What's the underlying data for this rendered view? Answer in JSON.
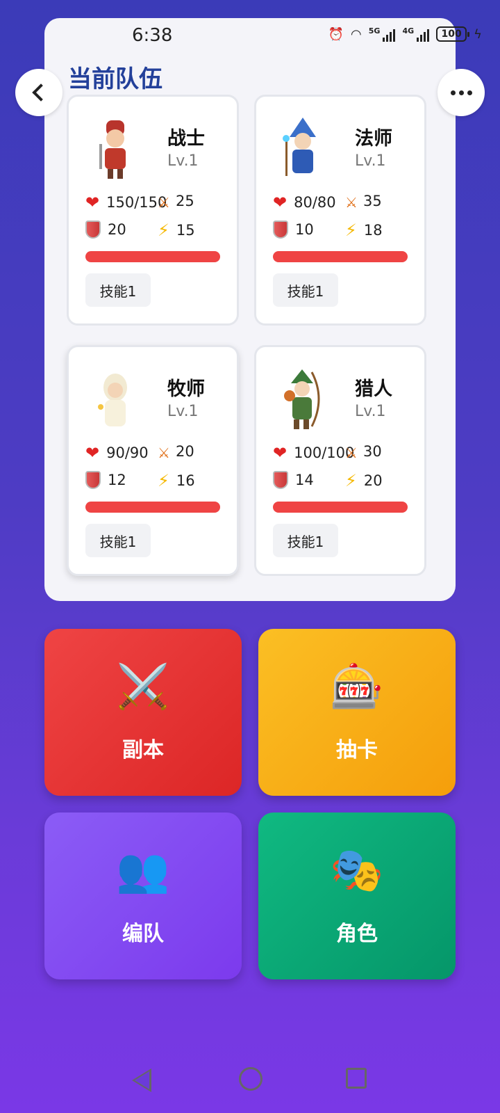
{
  "status": {
    "time": "6:38",
    "net1": "5G",
    "net2": "4G",
    "battery": "100"
  },
  "team": {
    "title": "当前队伍",
    "heroes": [
      {
        "name": "战士",
        "level": "Lv.1",
        "hp": "150/150",
        "atk": "25",
        "def": "20",
        "spd": "15",
        "skill": "技能1",
        "portrait": "warrior-portrait"
      },
      {
        "name": "法师",
        "level": "Lv.1",
        "hp": "80/80",
        "atk": "35",
        "def": "10",
        "spd": "18",
        "skill": "技能1",
        "portrait": "mage-portrait"
      },
      {
        "name": "牧师",
        "level": "Lv.1",
        "hp": "90/90",
        "atk": "20",
        "def": "12",
        "spd": "16",
        "skill": "技能1",
        "portrait": "priest-portrait"
      },
      {
        "name": "猎人",
        "level": "Lv.1",
        "hp": "100/100",
        "atk": "30",
        "def": "14",
        "spd": "20",
        "skill": "技能1",
        "portrait": "hunter-portrait"
      }
    ]
  },
  "menu": {
    "dungeon": {
      "label": "副本",
      "icon": "⚔️"
    },
    "gacha": {
      "label": "抽卡",
      "icon": "🎰"
    },
    "team": {
      "label": "编队",
      "icon": "👥"
    },
    "role": {
      "label": "角色",
      "icon": "🎭"
    }
  },
  "icons": {
    "hp": "❤",
    "atk": "⚔",
    "spd": "⚡"
  }
}
